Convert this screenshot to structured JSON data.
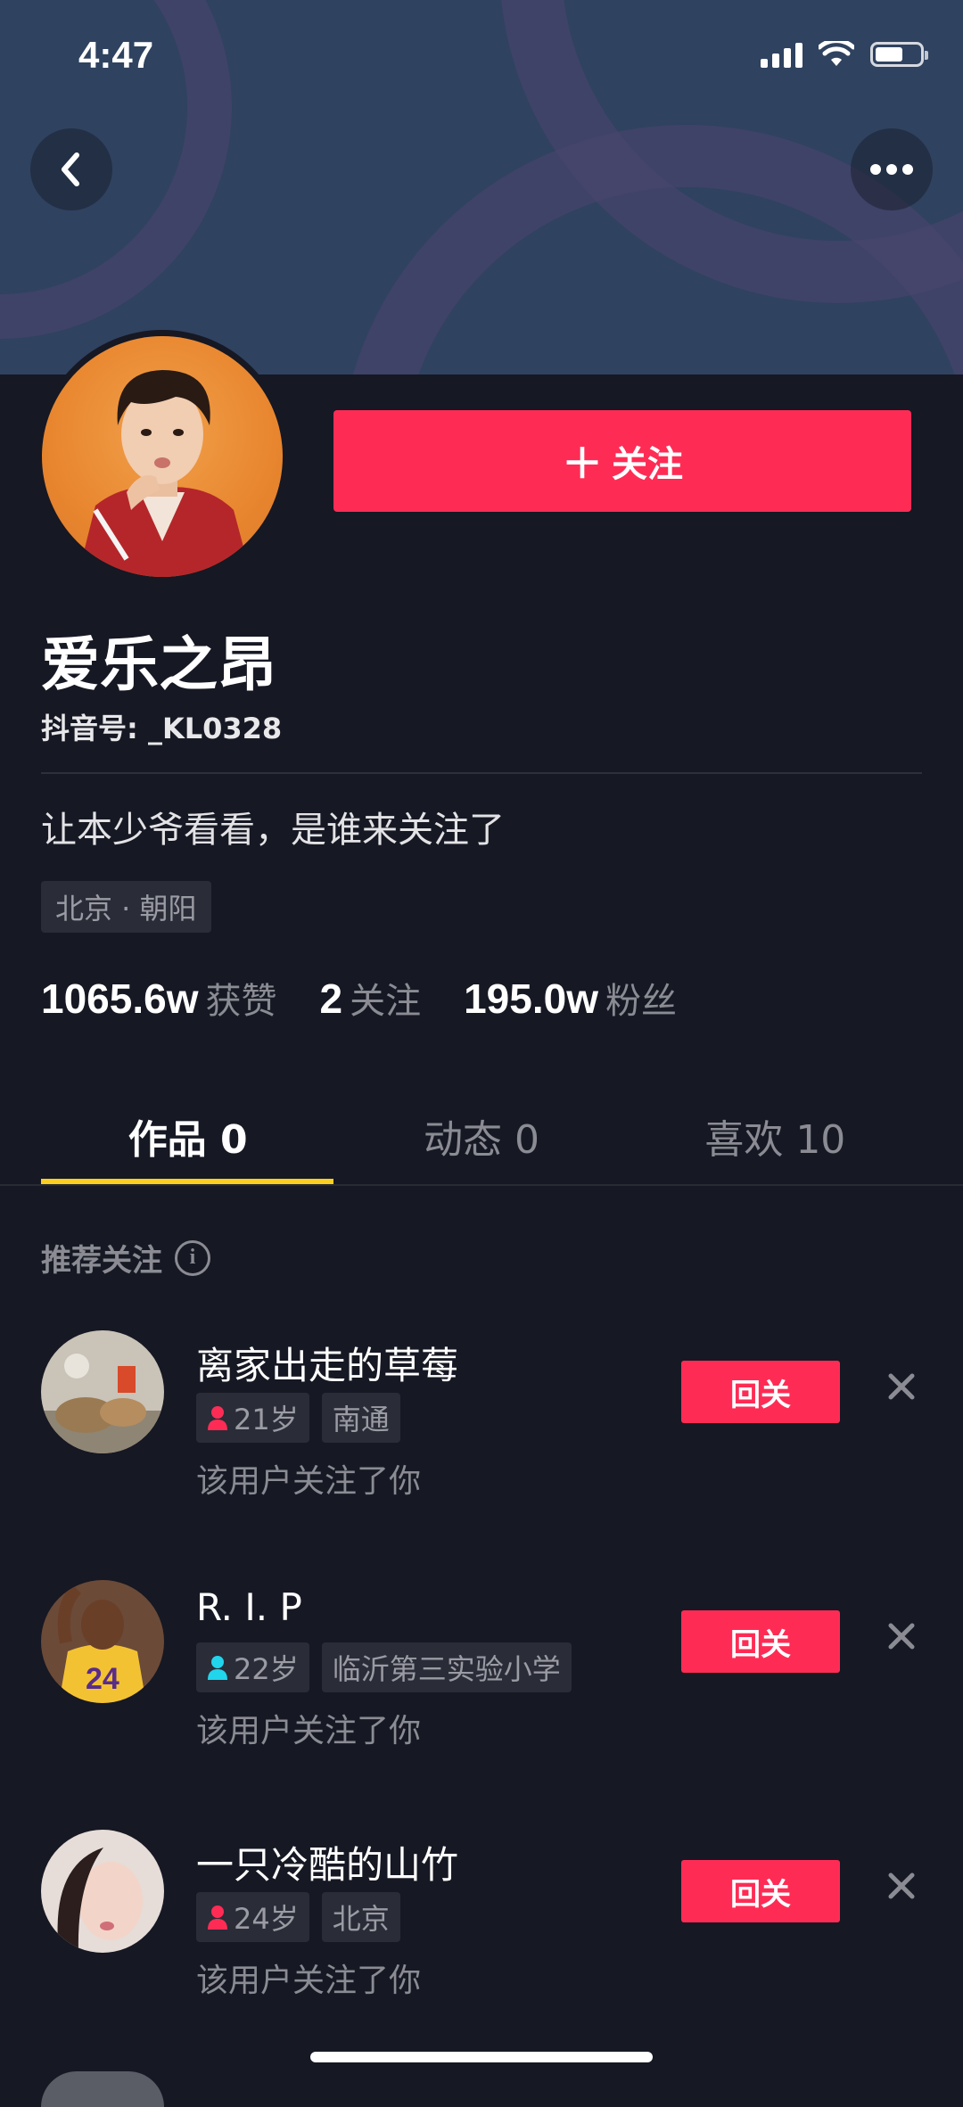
{
  "status_bar": {
    "time": "4:47"
  },
  "header": {
    "back_icon": "chevron-left-icon",
    "more_icon": "more-dots-icon"
  },
  "profile": {
    "follow_button": "关注",
    "nickname": "爱乐之昂",
    "douyin_id": "抖音号: _KL0328",
    "bio": "让本少爷看看，是谁来关注了",
    "location": "北京 · 朝阳",
    "stats": [
      {
        "num": "1065.6w",
        "label": "获赞"
      },
      {
        "num": "2",
        "label": "关注"
      },
      {
        "num": "195.0w",
        "label": "粉丝"
      }
    ]
  },
  "tabs": [
    {
      "label": "作品 0",
      "active": true
    },
    {
      "label": "动态 0",
      "active": false
    },
    {
      "label": "喜欢 10",
      "active": false
    }
  ],
  "recommend": {
    "title": "推荐关注",
    "items": [
      {
        "name": "离家出走的草莓",
        "age": "21岁",
        "gender": "female",
        "tag": "南通",
        "subtitle": "该用户关注了你",
        "button": "回关"
      },
      {
        "name": "R. I. P",
        "age": "22岁",
        "gender": "male",
        "tag": "临沂第三实验小学",
        "subtitle": "该用户关注了你",
        "button": "回关"
      },
      {
        "name": "一只冷酷的山竹",
        "age": "24岁",
        "gender": "female",
        "tag": "北京",
        "subtitle": "该用户关注了你",
        "button": "回关"
      }
    ]
  },
  "colors": {
    "accent": "#fe2c55",
    "background": "#161823",
    "tab_underline": "#facf21",
    "female": "#fe2c55",
    "male": "#20d5ec"
  }
}
